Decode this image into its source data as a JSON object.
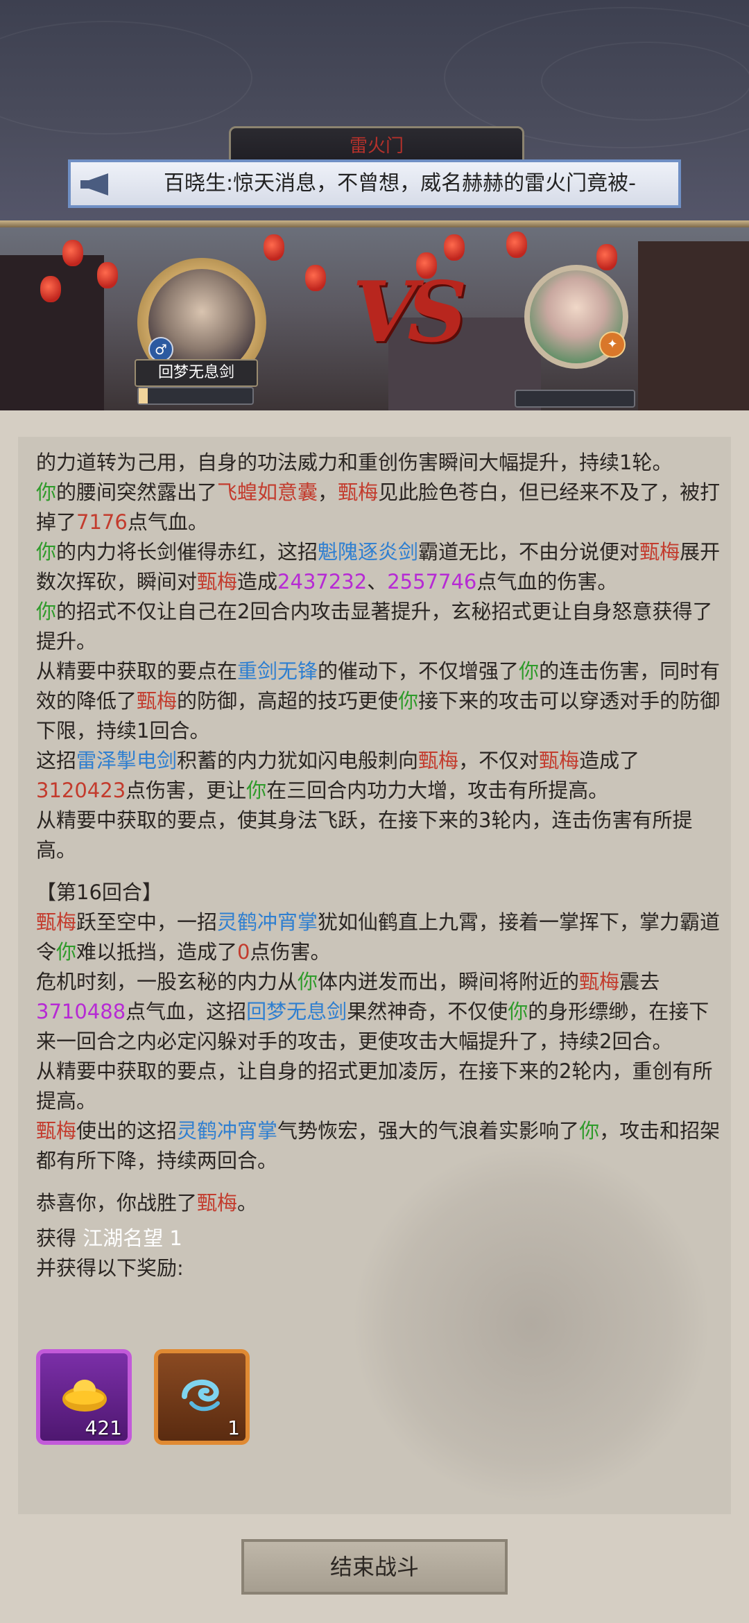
{
  "header": {
    "location_title": "雷火门",
    "marquee_text": "百晓生:惊天消息，不曾想，威名赫赫的雷火门竟被-"
  },
  "battle": {
    "player_name": "回梦无息剑",
    "player_gender_icon": "male-icon",
    "vs_text": "VS",
    "player_hp_fraction": 0.08,
    "enemy_hp_fraction": 0.0
  },
  "log": {
    "l1": "的力道转为己用，自身的功法威力和重创伤害瞬间大幅提升，持续1轮。",
    "l2a": "你",
    "l2b": "的腰间突然露出了",
    "l2c": "飞蝗如意囊",
    "l2d": "，",
    "l2e": "甄梅",
    "l2f": "见此脸色苍白，但已经来不及了，被打掉了",
    "l2g": "7176",
    "l2h": "点气血。",
    "l3a": "你",
    "l3b": "的内力将长剑催得赤红，这招",
    "l3c": "魁隗逐炎剑",
    "l3d": "霸道无比，不由分说便对",
    "l3e": "甄梅",
    "l3f": "展开数次挥砍，瞬间对",
    "l3g": "甄梅",
    "l3h": "造成",
    "l3i": "2437232",
    "l3j": "、",
    "l3k": "2557746",
    "l3l": "点气血的伤害。",
    "l4a": "你",
    "l4b": "的招式不仅让自己在2回合内攻击显著提升，玄秘招式更让自身怒意获得了提升。",
    "l5a": "从精要中获取的要点在",
    "l5b": "重剑无锋",
    "l5c": "的催动下，不仅增强了",
    "l5d": "你",
    "l5e": "的连击伤害，同时有效的降低了",
    "l5f": "甄梅",
    "l5g": "的防御，高超的技巧更使",
    "l5h": "你",
    "l5i": "接下来的攻击可以穿透对手的防御下限，持续1回合。",
    "l6a": "这招",
    "l6b": "雷泽掣电剑",
    "l6c": "积蓄的内力犹如闪电般刺向",
    "l6d": "甄梅",
    "l6e": "，不仅对",
    "l6f": "甄梅",
    "l6g": "造成了",
    "l6h": "3120423",
    "l6i": "点伤害，更让",
    "l6j": "你",
    "l6k": "在三回合内功力大增，攻击有所提高。",
    "l7": "从精要中获取的要点，使其身法飞跃，在接下来的3轮内，连击伤害有所提高。",
    "round": "【第16回合】",
    "l8a": "甄梅",
    "l8b": "跃至空中，一招",
    "l8c": "灵鹤冲宵掌",
    "l8d": "犹如仙鹤直上九霄，接着一掌挥下，掌力霸道令",
    "l8e": "你",
    "l8f": "难以抵挡，造成了",
    "l8g": "0",
    "l8h": "点伤害。",
    "l9a": "危机时刻，一股玄秘的内力从",
    "l9b": "你",
    "l9c": "体内迸发而出，瞬间将附近的",
    "l9d": "甄梅",
    "l9e": "震去",
    "l9f": "3710488",
    "l9g": "点气血，这招",
    "l9h": "回梦无息剑",
    "l9i": "果然神奇，不仅使",
    "l9j": "你",
    "l9k": "的身形缥缈，在接下来一回合之内必定闪躲对手的攻击，更使攻击大幅提升了，持续2回合。",
    "l10": "从精要中获取的要点，让自身的招式更加凌厉，在接下来的2轮内，重创有所提高。",
    "l11a": "甄梅",
    "l11b": "使出的这招",
    "l11c": "灵鹤冲宵掌",
    "l11d": "气势恢宏，强大的气浪着实影响了",
    "l11e": "你",
    "l11f": "，攻击和招架都有所下降，持续两回合。",
    "win_a": "恭喜你，你战胜了",
    "win_b": "甄梅",
    "win_c": "。",
    "gain_a": "获得 ",
    "gain_b": "江湖名望 1",
    "rewards_label": "并获得以下奖励:"
  },
  "rewards": [
    {
      "icon": "gold-ingot-icon",
      "count": "421"
    },
    {
      "icon": "cloud-swirl-icon",
      "count": "1"
    }
  ],
  "footer": {
    "end_button": "结束战斗"
  },
  "colors": {
    "self": "#2e9b2a",
    "enemy": "#c33b2d",
    "skill": "#2f7fd0",
    "crit": "#b62ad4"
  }
}
